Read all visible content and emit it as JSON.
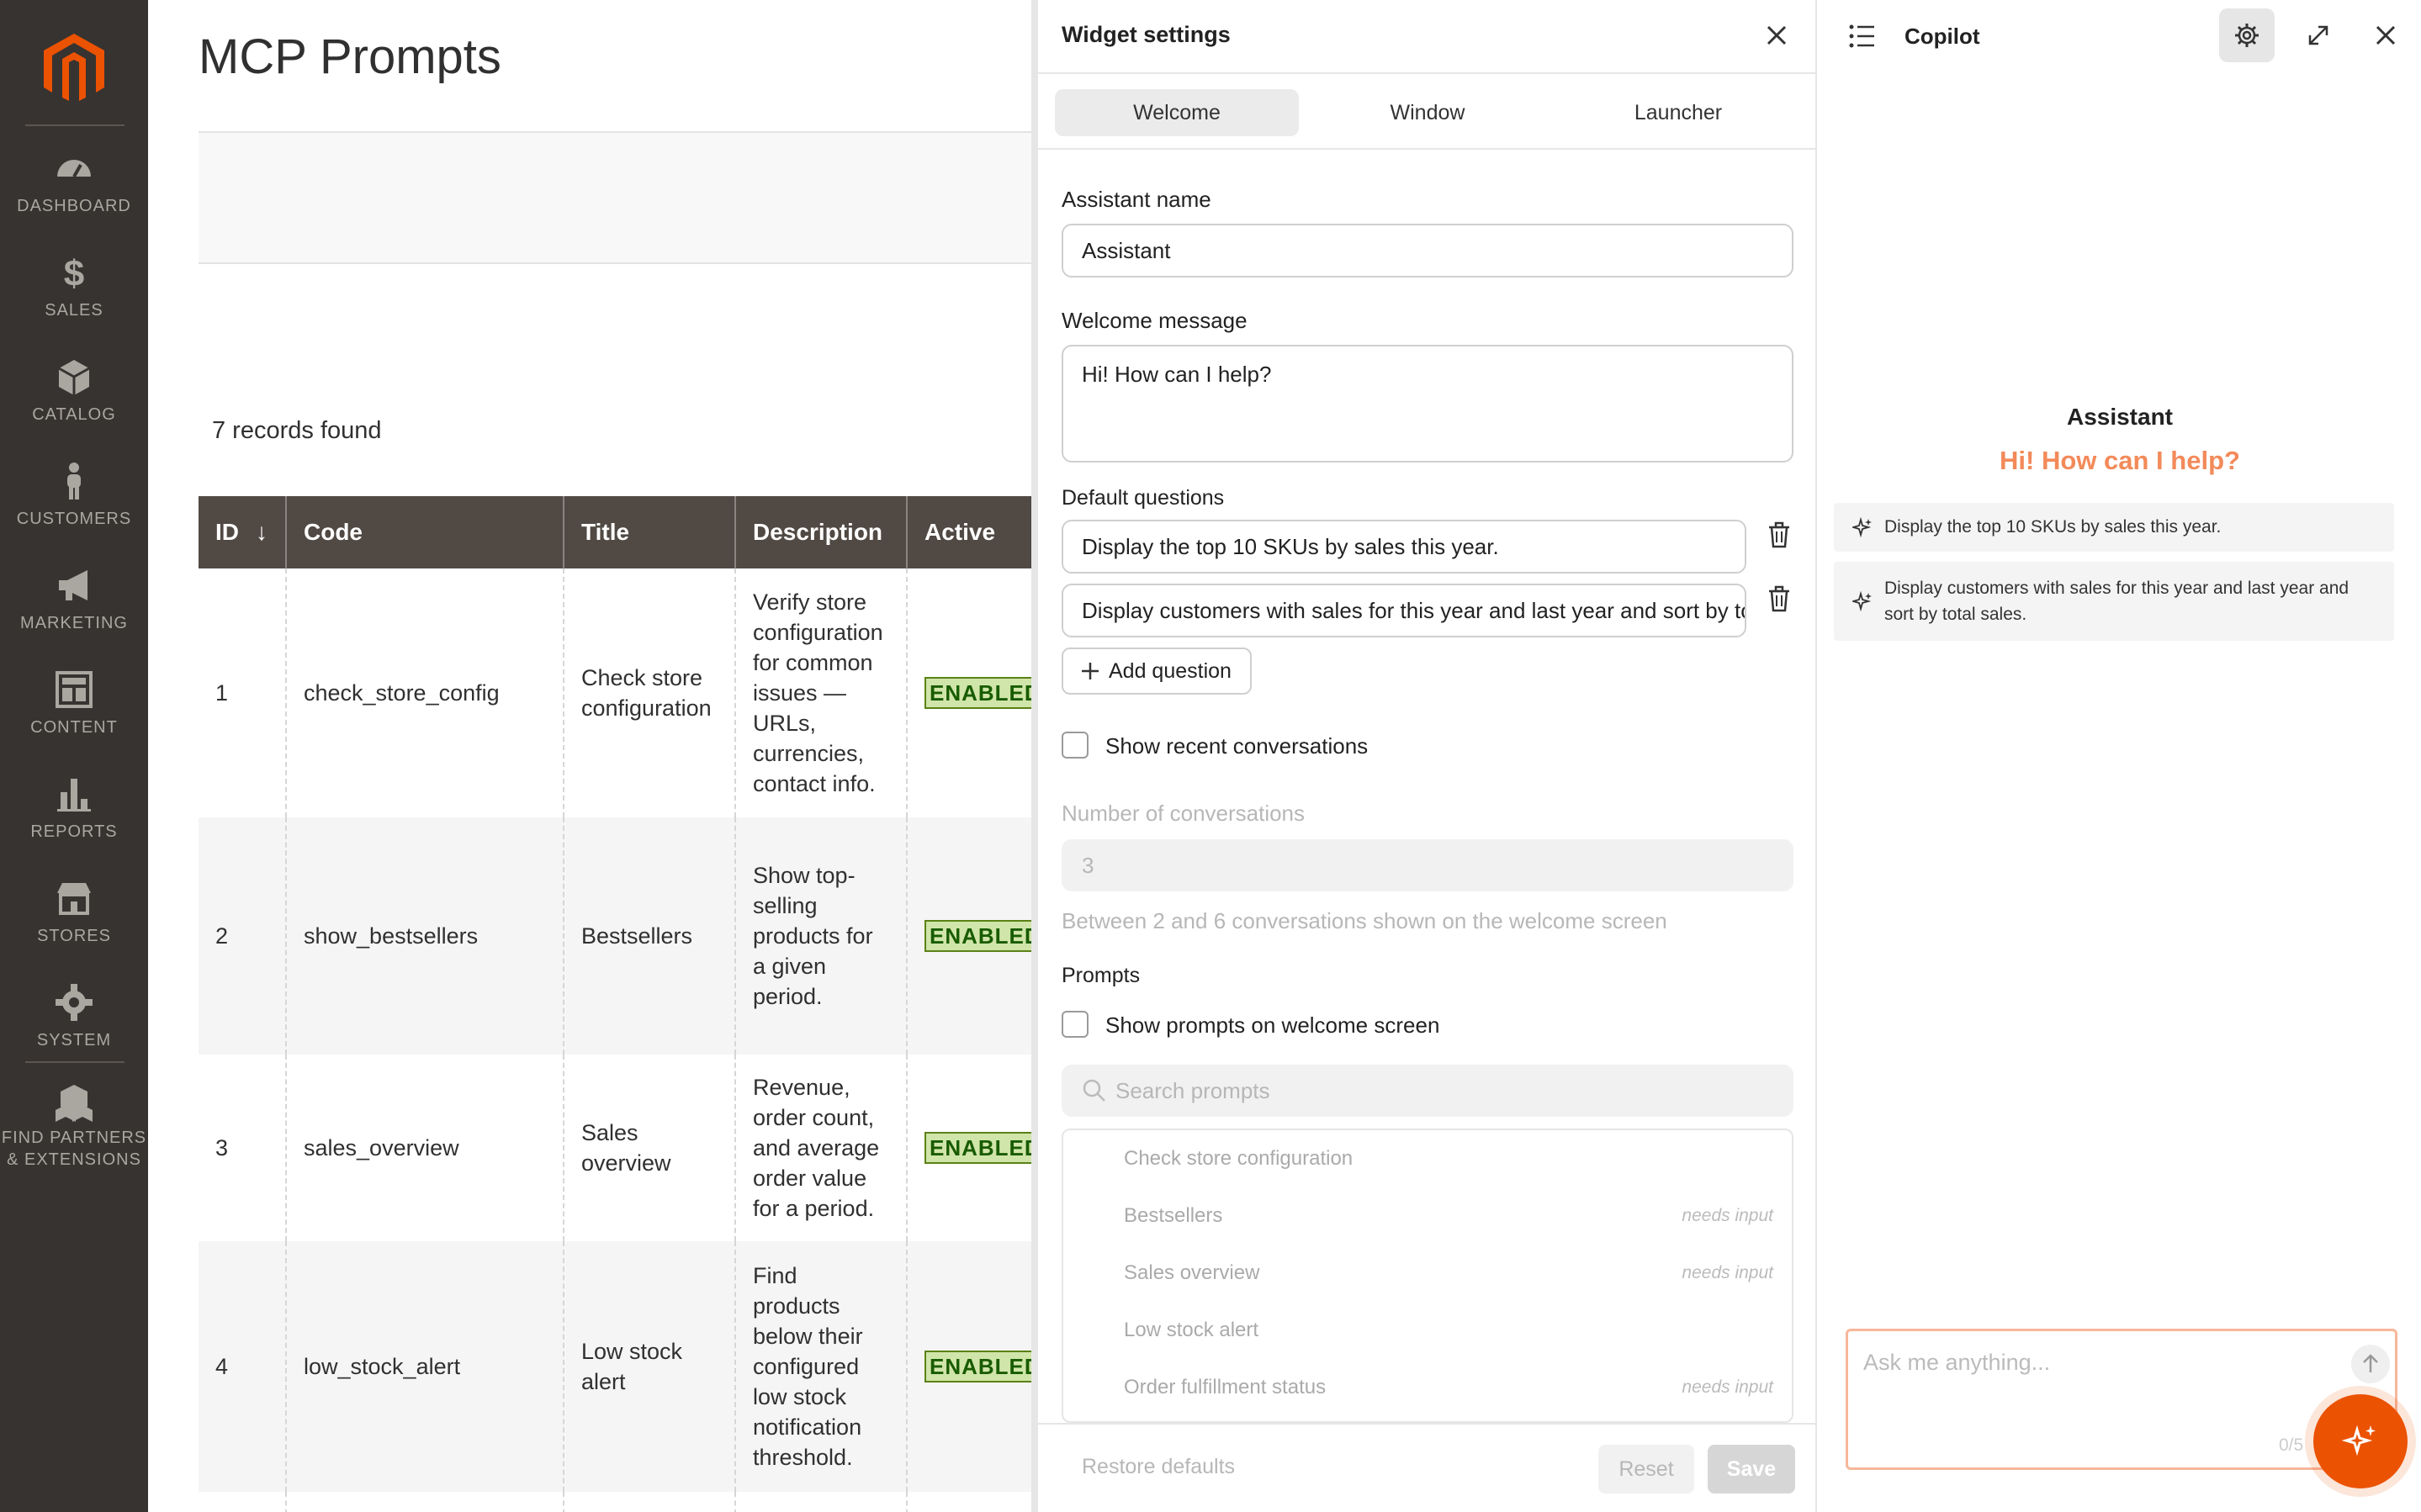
{
  "nav": {
    "items": [
      {
        "label": "DASHBOARD",
        "icon": "dashboard-icon"
      },
      {
        "label": "SALES",
        "icon": "dollar-icon"
      },
      {
        "label": "CATALOG",
        "icon": "box-icon"
      },
      {
        "label": "CUSTOMERS",
        "icon": "person-icon"
      },
      {
        "label": "MARKETING",
        "icon": "megaphone-icon"
      },
      {
        "label": "CONTENT",
        "icon": "layout-icon"
      },
      {
        "label": "REPORTS",
        "icon": "bar-chart-icon"
      },
      {
        "label": "STORES",
        "icon": "storefront-icon"
      },
      {
        "label": "SYSTEM",
        "icon": "gear-icon"
      },
      {
        "label": "FIND PARTNERS",
        "label2": "& EXTENSIONS",
        "icon": "cubes-icon"
      }
    ]
  },
  "page": {
    "title": "MCP Prompts",
    "records_found": "7 records found"
  },
  "grid": {
    "columns": [
      "ID",
      "Code",
      "Title",
      "Description",
      "Active"
    ],
    "sort_indicator": "↓",
    "rows": [
      {
        "id": "1",
        "code": "check_store_config",
        "title": "Check store configuration",
        "description": "Verify store configuration for common issues — URLs, currencies, contact info.",
        "active": "ENABLED"
      },
      {
        "id": "2",
        "code": "show_bestsellers",
        "title": "Bestsellers",
        "description": "Show top-selling products for a given period.",
        "active": "ENABLED"
      },
      {
        "id": "3",
        "code": "sales_overview",
        "title": "Sales overview",
        "description": "Revenue, order count, and average order value for a period.",
        "active": "ENABLED"
      },
      {
        "id": "4",
        "code": "low_stock_alert",
        "title": "Low stock alert",
        "description": "Find products below their configured low stock notification threshold.",
        "active": "ENABLED"
      }
    ]
  },
  "widget": {
    "header": "Widget settings",
    "tabs": [
      "Welcome",
      "Window",
      "Launcher"
    ],
    "active_tab": "Welcome",
    "assistant_name_label": "Assistant name",
    "assistant_name_value": "Assistant",
    "welcome_message_label": "Welcome message",
    "welcome_message_value": "Hi! How can I help?",
    "default_questions_label": "Default questions",
    "questions": [
      "Display the top 10 SKUs by sales this year.",
      "Display customers with sales for this year and last year and sort by total sales."
    ],
    "add_question": "Add question",
    "show_recent_label": "Show recent conversations",
    "num_conversations_label": "Number of conversations",
    "num_conversations_value": "3",
    "num_conversations_hint": "Between 2 and 6 conversations shown on the welcome screen",
    "prompts_label": "Prompts",
    "show_prompts_label": "Show prompts on welcome screen",
    "search_placeholder": "Search prompts",
    "prompt_items": [
      {
        "name": "Check store configuration",
        "tag": ""
      },
      {
        "name": "Bestsellers",
        "tag": "needs input"
      },
      {
        "name": "Sales overview",
        "tag": "needs input"
      },
      {
        "name": "Low stock alert",
        "tag": ""
      },
      {
        "name": "Order fulfillment status",
        "tag": "needs input"
      }
    ],
    "restore_defaults": "Restore defaults",
    "reset": "Reset",
    "save": "Save"
  },
  "copilot": {
    "title": "Copilot",
    "assistant_name": "Assistant",
    "welcome": "Hi! How can I help?",
    "suggestions": [
      "Display the top 10 SKUs by sales this year.",
      "Display customers with sales for this year and last year and sort by total sales."
    ],
    "input_placeholder": "Ask me anything...",
    "counter": "0/5",
    "accent_color": "#eb5202"
  }
}
